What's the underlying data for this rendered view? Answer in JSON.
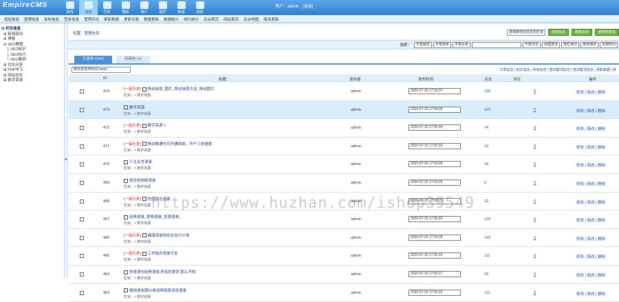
{
  "app": {
    "logo": "EmpireCMS"
  },
  "topnav": [
    {
      "label": "系统",
      "icon": "system-icon"
    },
    {
      "label": "信息",
      "icon": "info-icon",
      "active": true
    },
    {
      "label": "栏目",
      "icon": "column-icon"
    },
    {
      "label": "模板",
      "icon": "template-icon"
    },
    {
      "label": "用户",
      "icon": "user-icon"
    },
    {
      "label": "插件",
      "icon": "plugin-icon"
    },
    {
      "label": "商城",
      "icon": "shop-icon"
    },
    {
      "label": "其他",
      "icon": "other-icon"
    }
  ],
  "userinfo": {
    "label": "用户：admin",
    "logout": "[退出]"
  },
  "menubar": [
    "增加信息",
    "管理信息",
    "审核信息",
    "签发信息",
    "管理评论",
    "更新数据",
    "更新专题",
    "数据更新",
    "数据统计",
    "排行统计",
    "后台首页",
    "网站首页",
    "后台地图",
    "版本更新"
  ],
  "tree": [
    {
      "text": "⊟ 栏目信息",
      "bold": true
    },
    {
      "text": "  ⊞ 新闻资讯"
    },
    {
      "text": "  ⊞ 博客"
    },
    {
      "text": "  ⊟ SEO教程"
    },
    {
      "text": "     ├ SEO知识"
    },
    {
      "text": "     ├ SEO技巧"
    },
    {
      "text": "     └ SEO案例"
    },
    {
      "text": "  ⊞ 优化问答"
    },
    {
      "text": "  ⊞ PHP学习"
    },
    {
      "text": "  ⊞ 网站优化"
    },
    {
      "text": "  ⊞ 数字资源"
    }
  ],
  "position": {
    "label": "位置：",
    "value": "管理信息"
  },
  "actions": {
    "select": "选择要增加信息的栏目",
    "add": "增加信息",
    "refresh": "刷新首页",
    "refresh_all": "刷新所有信"
  },
  "search": {
    "label": "搜索：",
    "filters": [
      "不限属性",
      "不限排序",
      "不限头条",
      "不限评论",
      "标题查询",
      "按栏目ID",
      "排序顺序",
      "全部时间"
    ]
  },
  "tabs": [
    {
      "label": "已发布 (204)",
      "active": true
    },
    {
      "label": "待审核 (0)",
      "active": false
    }
  ],
  "toolbar": {
    "sort_select": "按信息发布时间 (new)",
    "links": "只发信息 | 批次信息 | 所有信息 | 查询置顶信息 | 查询置顶信息 | 更新数据 | 转"
  },
  "table": {
    "headers": {
      "id": "ID",
      "title": "标题",
      "author": "发布者",
      "time": "发布时间",
      "clicks": "点击",
      "comments": "评论",
      "ops": "操作"
    },
    "column_sub": "栏目：> 数字资源",
    "op_labels": "修改 | 简改 | 删除",
    "rows": [
      {
        "id": "474",
        "tag": "[一级头条]",
        "title": "移动信息_图片_移动信息大全_移动图片",
        "author": "admin",
        "time": "2020-07-20 17:50:37",
        "clicks": "139",
        "comments": "0"
      },
      {
        "id": "473",
        "tag": "",
        "title": "数字资源",
        "author": "admin",
        "time": "2020-07-20 17:50:35",
        "clicks": "123",
        "comments": "0",
        "hl": true
      },
      {
        "id": "472",
        "tag": "[一级头条]",
        "title": "数字资源 1",
        "author": "admin",
        "time": "2020-07-20 17:50:34",
        "clicks": "74",
        "comments": "0"
      },
      {
        "id": "471",
        "tag": "[一级头条]",
        "title": "移动联通也可开通网络，开户三块速度",
        "author": "admin",
        "time": "2020-07-20 17:50:33",
        "clicks": "14",
        "comments": "0"
      },
      {
        "id": "470",
        "tag": "",
        "title": "人生名言语录",
        "author": "admin",
        "time": "2020-07-20 17:50:28",
        "clicks": "34",
        "comments": "0"
      },
      {
        "id": "469",
        "tag": "",
        "title": "常见的网络语录",
        "author": "admin",
        "time": "2020-07-20 17:50:25",
        "clicks": "6",
        "comments": "0"
      },
      {
        "id": "468",
        "tag": "[一级头条]",
        "title": "伤感励志语录",
        "author": "admin",
        "time": "2020-07-20 17:50:23",
        "clicks": "32",
        "comments": "0"
      },
      {
        "id": "467",
        "tag": "",
        "title": "经典语录_爱情语录_伤感语录_",
        "author": "admin",
        "time": "2020-07-20 17:50:20",
        "clicks": "129",
        "comments": "0"
      },
      {
        "id": "466",
        "tag": "[一级头条]",
        "title": "健康语录网优化设计27条",
        "author": "admin",
        "time": "2020-07-20 17:50:18",
        "clicks": "143",
        "comments": "0"
      },
      {
        "id": "465",
        "tag": "[一级头条]",
        "title": "工作励志语录大全",
        "author": "admin",
        "time": "2020-07-20 17:50:16",
        "clicks": "111",
        "comments": "0"
      },
      {
        "id": "464",
        "tag": "",
        "title": "伤感语句经典语录,所有的爱好,那么不知",
        "author": "admin",
        "time": "2020-07-20 17:50:17",
        "clicks": "25",
        "comments": "0"
      },
      {
        "id": "463",
        "tag": "",
        "title": "微信朋友圈50条经典搞笑说说语录",
        "author": "admin",
        "time": "2020-07-20 17:50:15",
        "clicks": "121",
        "comments": "0"
      }
    ]
  },
  "watermark": "https://www.huzhan.com/ishop39549"
}
